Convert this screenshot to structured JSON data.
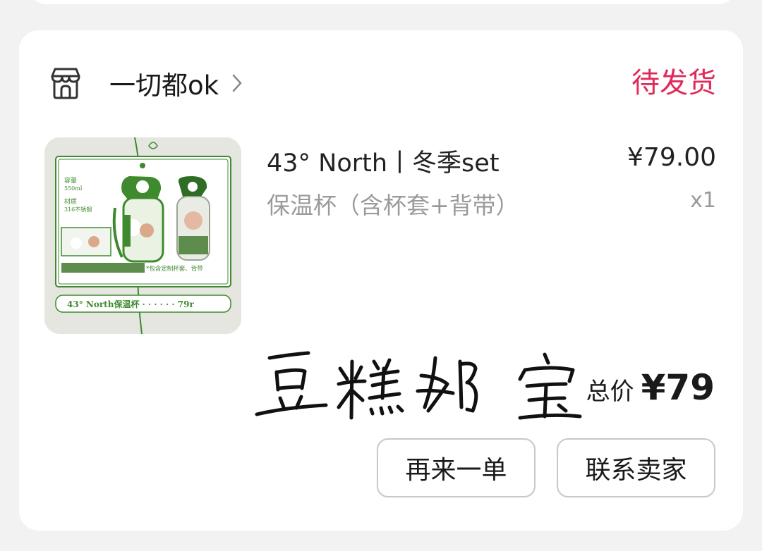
{
  "order": {
    "shop_name": "一切都ok",
    "status": "待发货",
    "product": {
      "title": "43° North丨冬季set",
      "variant": "保温杯（含杯套+背带）",
      "price": "¥79.00",
      "quantity": "x1",
      "thumbnail_text": {
        "capacity": "容量",
        "capacity_value": "550ml",
        "material": "材质",
        "material_value": "316不锈钢",
        "note": "*包含定制杯套、背带",
        "footer": "43° North保温杯 · · · · · · 79r"
      }
    },
    "signature_text": "豆糕奶宝",
    "total_label": "总价",
    "total_value": "¥79",
    "actions": {
      "reorder": "再来一单",
      "contact_seller": "联系卖家"
    }
  },
  "colors": {
    "status": "#e02a5b",
    "thumbnail_green": "#3f8a2e"
  },
  "icons": [
    "shop-icon",
    "chevron-right-icon"
  ]
}
